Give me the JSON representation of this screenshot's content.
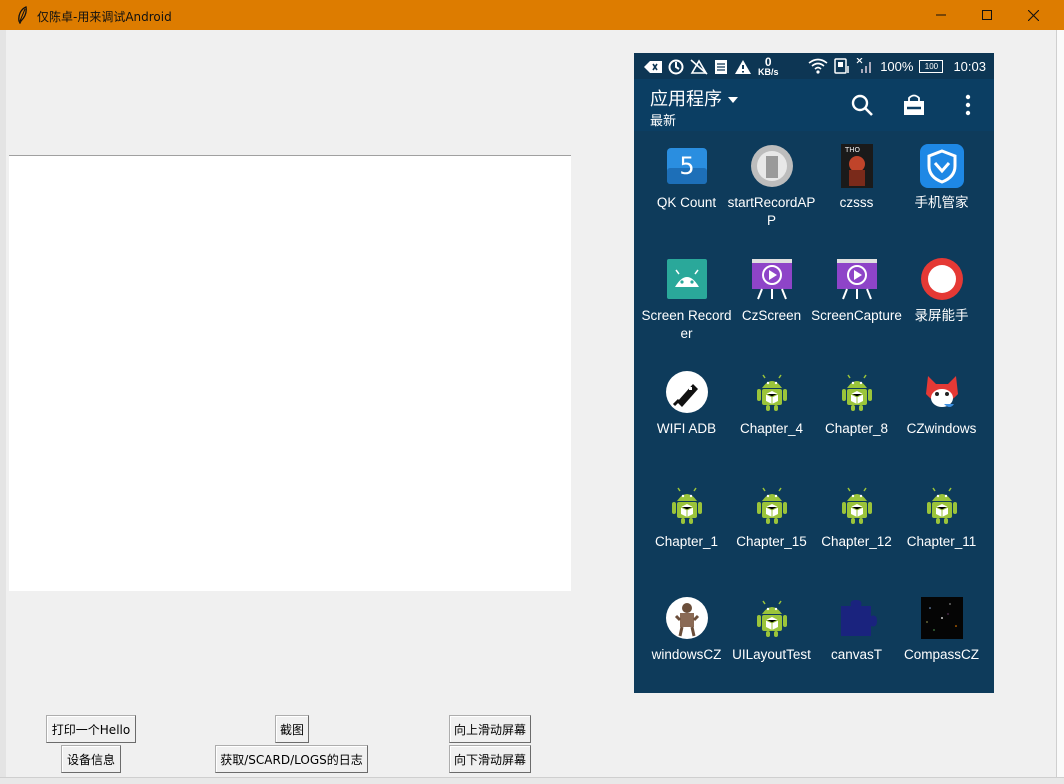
{
  "window": {
    "title": "仅陈卓-用来调试Android"
  },
  "buttons": {
    "print_hello": "打印一个Hello",
    "device_info": "设备信息",
    "screenshot": "截图",
    "get_logs": "获取/SCARD/LOGS的日志",
    "scroll_up": "向上滑动屏幕",
    "scroll_down": "向下滑动屏幕"
  },
  "phone": {
    "status": {
      "speed_value": "0",
      "speed_unit": "KB/s",
      "battery": "100%",
      "battery_icon_text": "100",
      "time": "10:03"
    },
    "header": {
      "title": "应用程序",
      "subtitle": "最新"
    },
    "apps": [
      {
        "label": "QK Count",
        "icon": "qk-count-icon"
      },
      {
        "label": "startRecordAPP",
        "icon": "start-record-icon"
      },
      {
        "label": "czsss",
        "icon": "czsss-icon"
      },
      {
        "label": "手机管家",
        "icon": "phone-manager-icon"
      },
      {
        "label": "Screen Recorder",
        "icon": "screen-recorder-icon"
      },
      {
        "label": "CzScreen",
        "icon": "projector-icon"
      },
      {
        "label": "ScreenCapture",
        "icon": "projector-icon"
      },
      {
        "label": "录屏能手",
        "icon": "record-button-icon"
      },
      {
        "label": "WIFI ADB",
        "icon": "wifi-adb-icon"
      },
      {
        "label": "Chapter_4",
        "icon": "android-icon"
      },
      {
        "label": "Chapter_8",
        "icon": "android-icon"
      },
      {
        "label": "CZwindows",
        "icon": "fox-icon"
      },
      {
        "label": "Chapter_1",
        "icon": "android-icon"
      },
      {
        "label": "Chapter_15",
        "icon": "android-icon"
      },
      {
        "label": "Chapter_12",
        "icon": "android-icon"
      },
      {
        "label": "Chapter_11",
        "icon": "android-icon"
      },
      {
        "label": "windowsCZ",
        "icon": "robot-icon"
      },
      {
        "label": "UILayoutTest",
        "icon": "android-icon"
      },
      {
        "label": "canvasT",
        "icon": "puzzle-icon"
      },
      {
        "label": "CompassCZ",
        "icon": "compass-icon"
      }
    ]
  },
  "colors": {
    "titlebar": "#dd7c00",
    "phone_bg": "#0e3b5b",
    "phone_actionbar": "#0b3e63",
    "android_green": "#9bc43a"
  }
}
